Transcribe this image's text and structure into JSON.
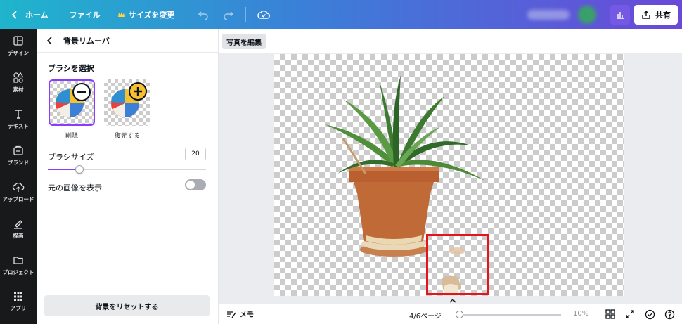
{
  "topbar": {
    "home_label": "ホーム",
    "file_label": "ファイル",
    "resize_label": "サイズを変更",
    "share_label": "共有"
  },
  "rail": {
    "items": [
      {
        "label": "デザイン",
        "icon": "layout-icon"
      },
      {
        "label": "素材",
        "icon": "shapes-icon"
      },
      {
        "label": "テキスト",
        "icon": "text-icon"
      },
      {
        "label": "ブランド",
        "icon": "brand-icon"
      },
      {
        "label": "アップロード",
        "icon": "upload-icon"
      },
      {
        "label": "描画",
        "icon": "draw-icon"
      },
      {
        "label": "プロジェクト",
        "icon": "folder-icon"
      },
      {
        "label": "アプリ",
        "icon": "apps-icon"
      }
    ]
  },
  "panel": {
    "title": "背景リムーバ",
    "brush_section": "ブラシを選択",
    "brush_erase": "削除",
    "brush_restore": "復元する",
    "brush_size_label": "ブラシサイズ",
    "brush_size_value": "20",
    "brush_size_fraction": 0.2,
    "show_original_label": "元の画像を表示",
    "show_original_on": false,
    "reset_label": "背景をリセットする"
  },
  "workspace": {
    "edit_photo_label": "写真を編集"
  },
  "bottombar": {
    "memo_label": "メモ",
    "page_label": "4/6ページ",
    "zoom_label": "10%",
    "zoom_fraction": 0.0
  },
  "colors": {
    "accent": "#8b3dff",
    "highlight": "#e4141c",
    "rail_bg": "#18191b"
  }
}
